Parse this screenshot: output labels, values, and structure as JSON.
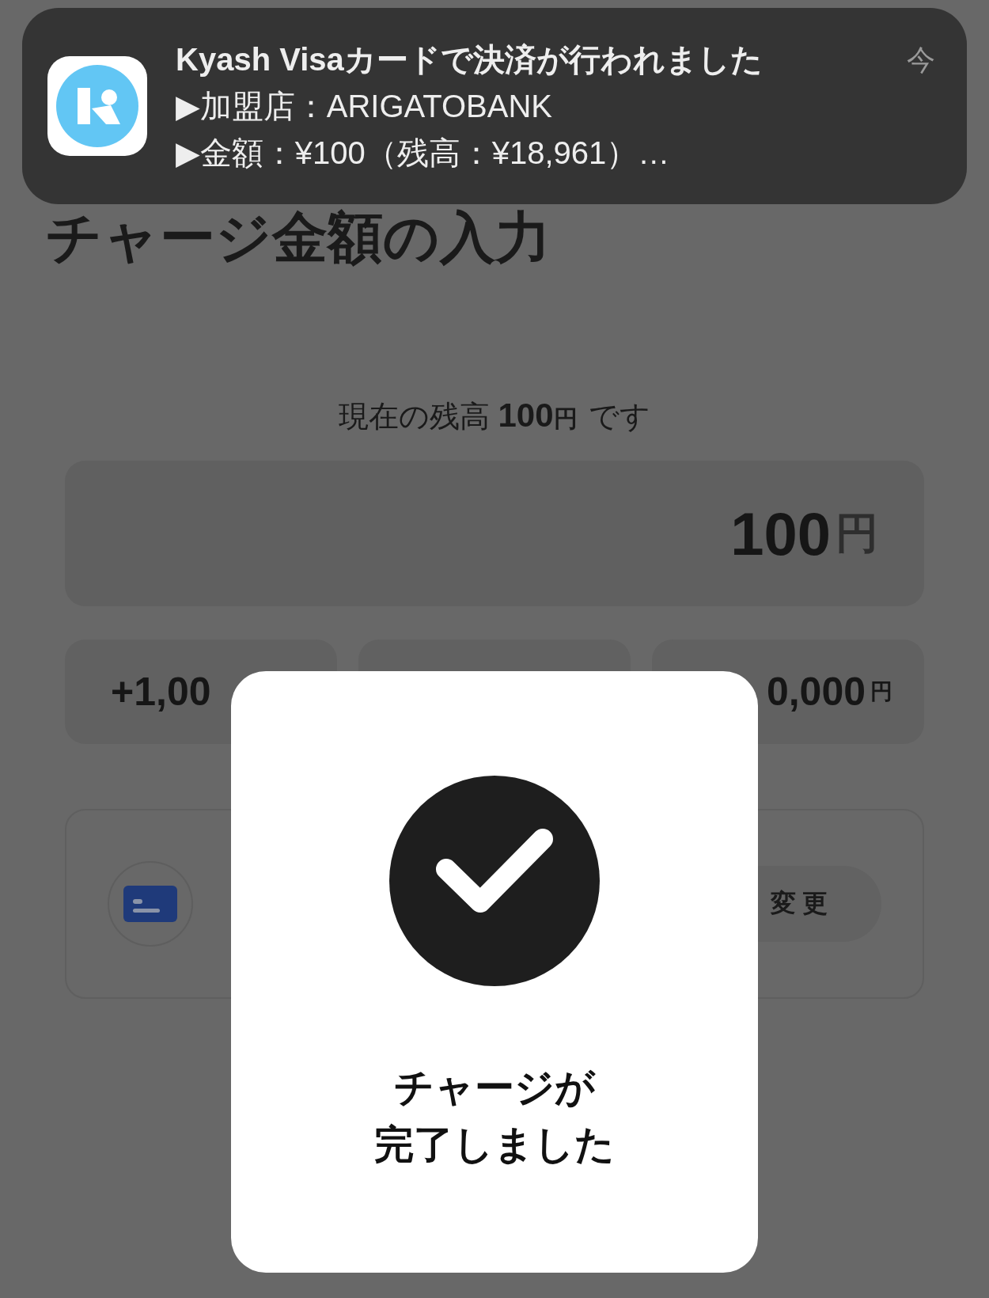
{
  "notification": {
    "title": "Kyash Visaカードで決済が行われました",
    "lines": [
      "▶加盟店：ARIGATOBANK",
      "▶金額：¥100（残高：¥18,961）…"
    ],
    "time": "今"
  },
  "heading": "チャージ金額の入力",
  "balance": {
    "prefix": "現在の残高",
    "amount": "100",
    "unit": "円",
    "suffix": "です"
  },
  "amount_field": {
    "value": "100",
    "unit": "円"
  },
  "presets": [
    {
      "kind": "left",
      "label": "+1,00"
    },
    {
      "kind": "covered"
    },
    {
      "kind": "right",
      "label": "0,000",
      "unit": "円"
    }
  ],
  "payment": {
    "change_button": "変更"
  },
  "modal": {
    "message": [
      "チャージが",
      "完了しました"
    ]
  }
}
